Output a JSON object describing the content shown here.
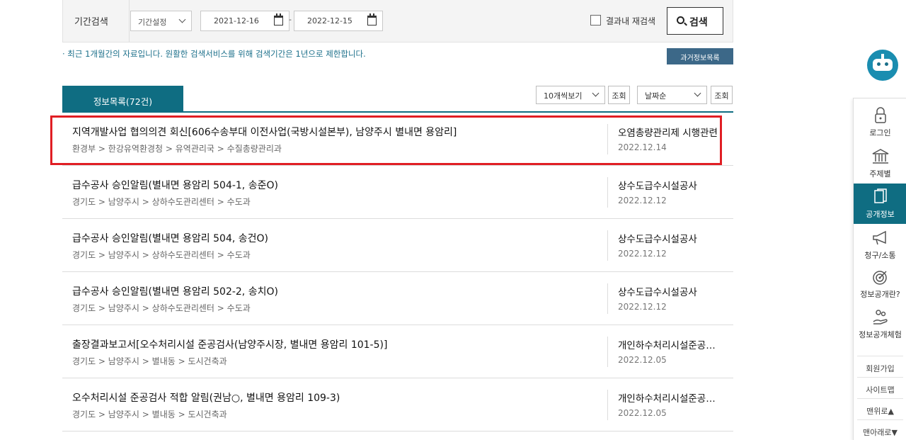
{
  "search": {
    "label": "기간검색",
    "period_select": "기간설정",
    "date_from": "2021-12-16",
    "date_sep": "-",
    "date_to": "2022-12-15",
    "research_label": "결과내 재검색",
    "button_label": "검색"
  },
  "notice": "· 최근 1개월간의 자료입니다. 원활한 검색서비스를 위해 검색기간은 1년으로 제한합니다.",
  "past_list_button": "과거정보목록",
  "list": {
    "tab_label": "정보목록(72건)",
    "page_size_select": "10개씩보기",
    "query_button_1": "조회",
    "sort_select": "날짜순",
    "query_button_2": "조회",
    "rows": [
      {
        "title": "지역개발사업 협의의견 회신[606수송부대 이전사업(국방시설본부), 남양주시 별내면 용암리]",
        "path": "환경부 > 한강유역환경청 > 유역관리국 > 수질총량관리과",
        "org": "오염총량관리제 시행관련",
        "date": "2022.12.14"
      },
      {
        "title": "급수공사 승인알림(별내면 용암리 504-1, 송준O)",
        "path": "경기도 > 남양주시 > 상하수도관리센터 > 수도과",
        "org": "상수도급수시설공사",
        "date": "2022.12.12"
      },
      {
        "title": "급수공사 승인알림(별내면 용암리 504, 송건O)",
        "path": "경기도 > 남양주시 > 상하수도관리센터 > 수도과",
        "org": "상수도급수시설공사",
        "date": "2022.12.12"
      },
      {
        "title": "급수공사 승인알림(별내면 용암리 502-2, 송치O)",
        "path": "경기도 > 남양주시 > 상하수도관리센터 > 수도과",
        "org": "상수도급수시설공사",
        "date": "2022.12.12"
      },
      {
        "title": "출장결과보고서[오수처리시설 준공검사(남양주시장, 별내면 용암리 101-5)]",
        "path": "경기도 > 남양주시 > 별내동 > 도시건축과",
        "org": "개인하수처리시설준공검사",
        "date": "2022.12.05"
      },
      {
        "title": "오수처리시설 준공검사 적합 알림(권남○, 별내면 용암리 109-3)",
        "path": "경기도 > 남양주시 > 별내동 > 도시건축과",
        "org": "개인하수처리시설준공검사",
        "date": "2022.12.05"
      }
    ]
  },
  "side_menu": {
    "login": "로그인",
    "by_topic": "주제별",
    "public_info": "공개정보",
    "request": "청구/소통",
    "what_is": "정보공개란?",
    "experience": "정보공개체험",
    "join": "회원가입",
    "sitemap": "사이트맵",
    "to_top": "맨위로▲",
    "to_bottom": "맨아래로▼"
  },
  "colors": {
    "accent": "#0f6d82",
    "highlight_border": "#e01e24",
    "notice_text": "#1b6f8a"
  }
}
